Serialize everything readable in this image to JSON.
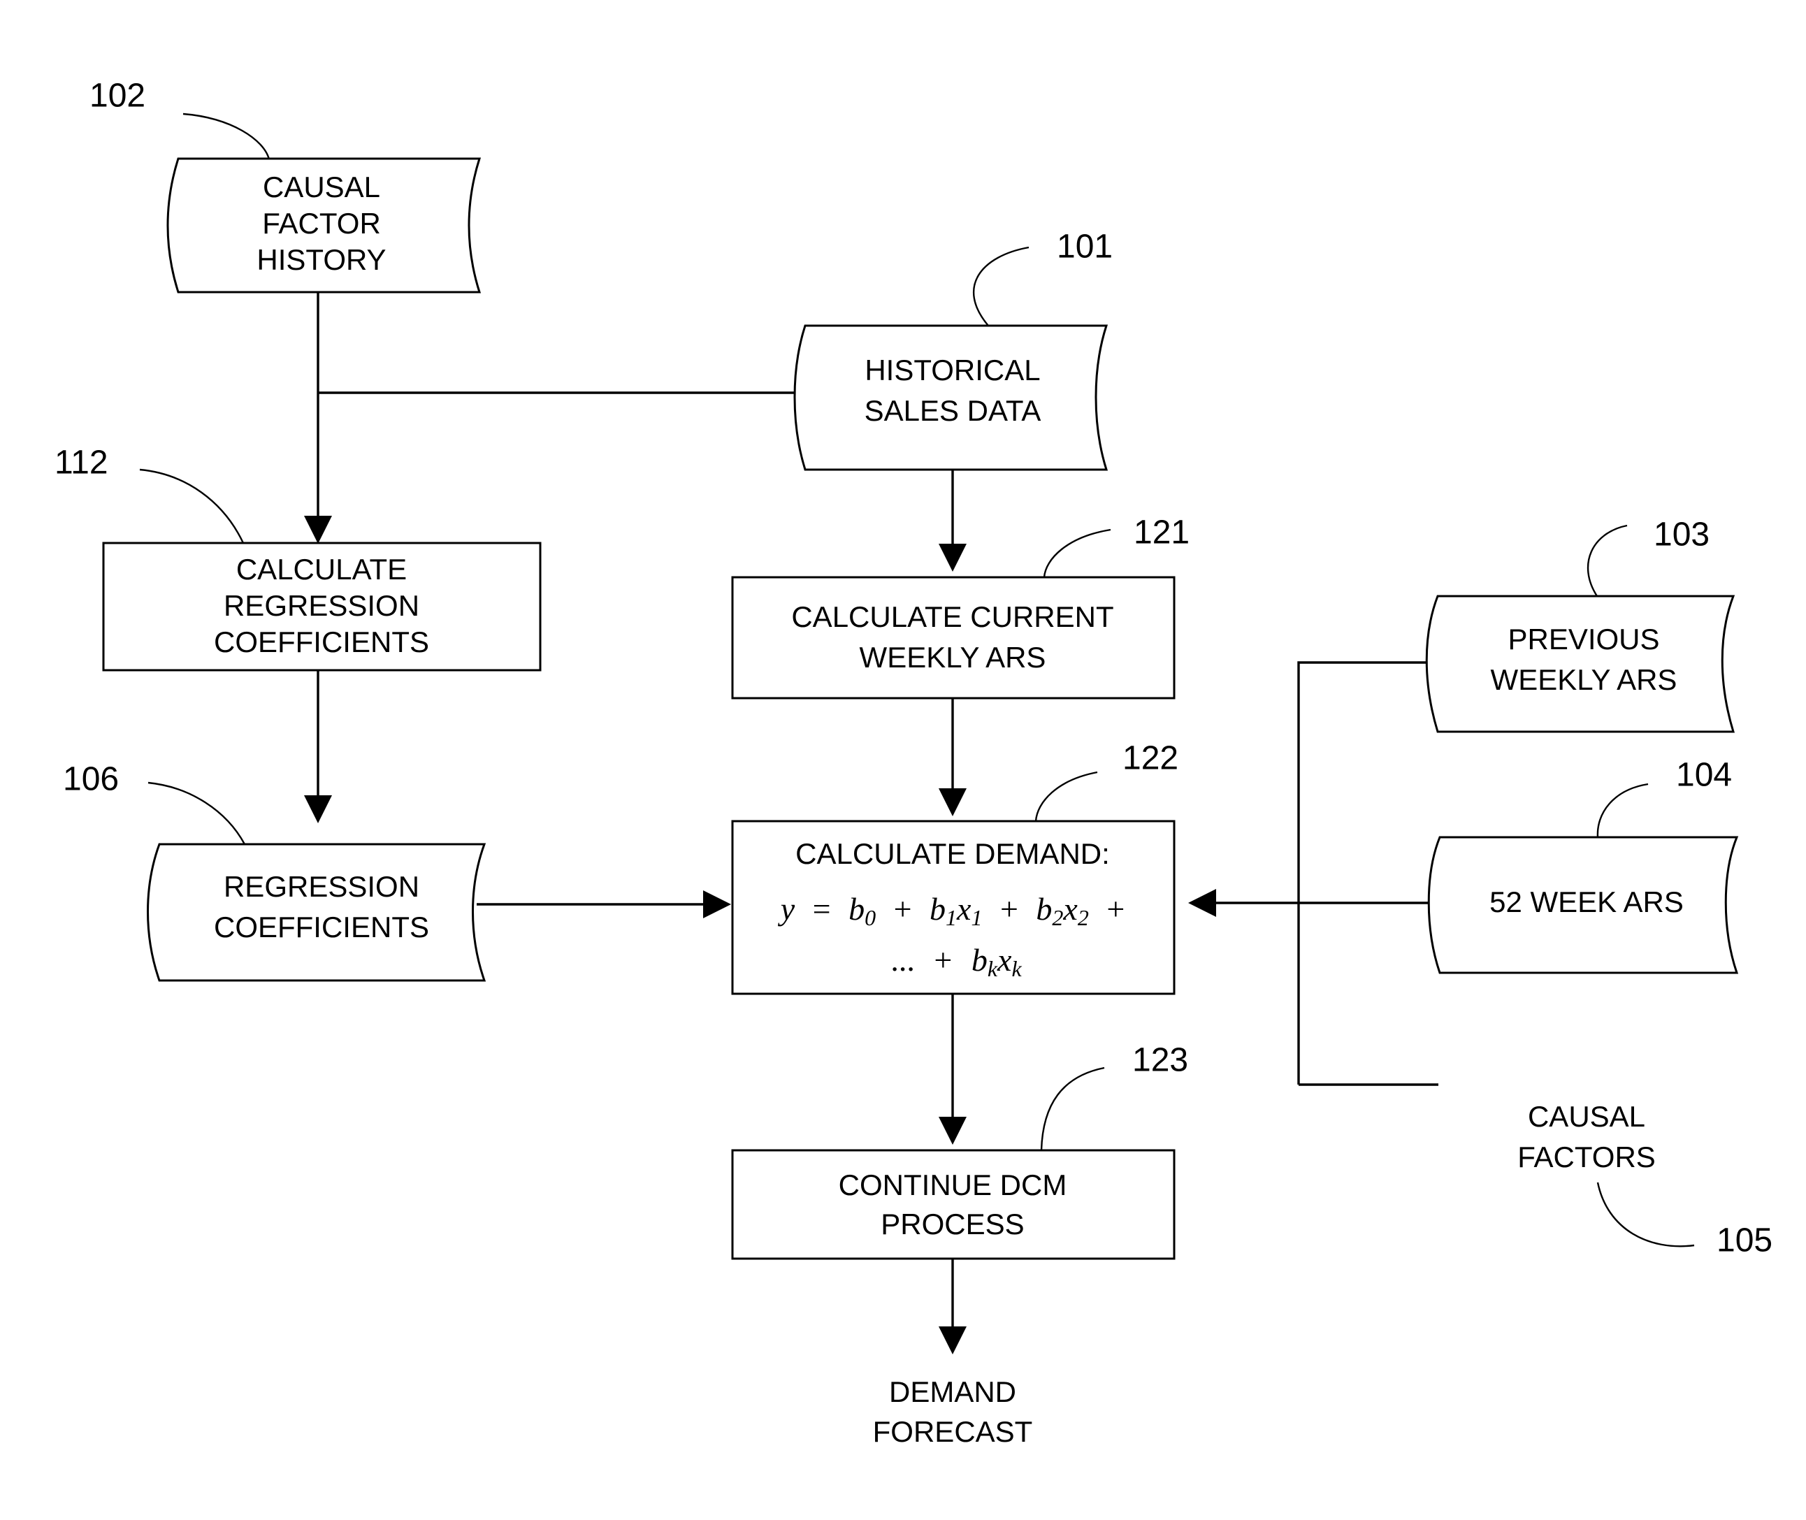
{
  "figure": {
    "type": "patent-flowchart",
    "background_color": "#ffffff",
    "line_color": "#000000"
  },
  "nodes": {
    "causal_factor_history": {
      "ref": "102",
      "shape": "data-store",
      "line1": "CAUSAL",
      "line2": "FACTOR",
      "line3": "HISTORY"
    },
    "historical_sales_data": {
      "ref": "101",
      "shape": "data-store",
      "line1": "HISTORICAL",
      "line2": "SALES DATA"
    },
    "calculate_regression_coefficients": {
      "ref": "112",
      "shape": "process",
      "line1": "CALCULATE",
      "line2": "REGRESSION",
      "line3": "COEFFICIENTS"
    },
    "calculate_current_weekly_ars": {
      "ref": "121",
      "shape": "process",
      "line1": "CALCULATE CURRENT",
      "line2": "WEEKLY ARS"
    },
    "regression_coefficients": {
      "ref": "106",
      "shape": "data-store",
      "line1": "REGRESSION",
      "line2": "COEFFICIENTS"
    },
    "calculate_demand": {
      "ref": "122",
      "shape": "process",
      "title": "CALCULATE DEMAND:",
      "formula_line1": {
        "y": "y",
        "eq": "=",
        "b0": "b",
        "b0_sub": "0",
        "plus1": "+",
        "b1": "b",
        "b1_sub": "1",
        "x1": "x",
        "x1_sub": "1",
        "plus2": "+",
        "b2": "b",
        "b2_sub": "2",
        "x2": "x",
        "x2_sub": "2",
        "plus3": "+"
      },
      "formula_line2": {
        "ellipsis": "...",
        "plus": "+",
        "bk": "b",
        "bk_sub": "k",
        "xk": "x",
        "xk_sub": "k"
      },
      "formula_plain": "y = b0 + b1x1 + b2x2 + ... + bkxk"
    },
    "previous_weekly_ars": {
      "ref": "103",
      "shape": "data-store",
      "line1": "PREVIOUS",
      "line2": "WEEKLY ARS"
    },
    "fifty_two_week_ars": {
      "ref": "104",
      "shape": "data-store",
      "line1": "52 WEEK ARS"
    },
    "causal_factors": {
      "ref": "105",
      "shape": "text-label",
      "line1": "CAUSAL",
      "line2": "FACTORS"
    },
    "continue_dcm_process": {
      "ref": "123",
      "shape": "process",
      "line1": "CONTINUE DCM",
      "line2": "PROCESS"
    },
    "demand_forecast": {
      "shape": "text-label",
      "line1": "DEMAND",
      "line2": "FORECAST"
    }
  }
}
